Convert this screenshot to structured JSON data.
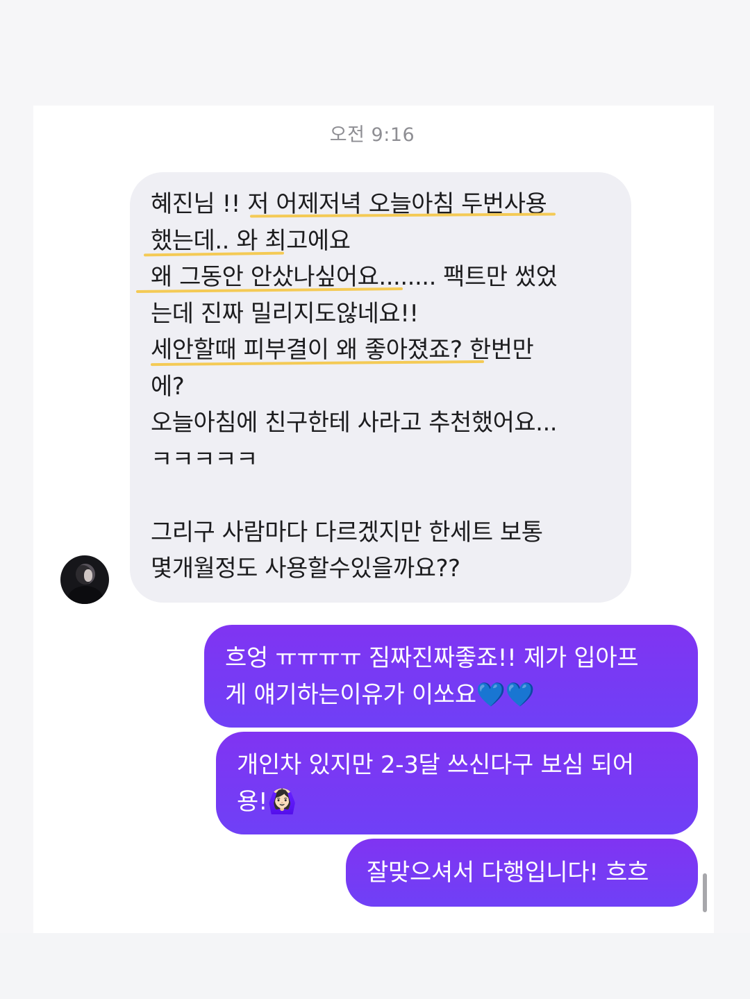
{
  "timestamp": "오전 9:16",
  "incoming_message": {
    "text": "혜진님 !! 저 어제저녁 오늘아침 두번사용\n했는데.. 와 최고에요\n왜 그동안 안샀나싶어요........ 팩트만 썼었\n는데 진짜 밀리지도않네요!!\n세안할때 피부결이 왜 좋아졌죠? 한번만\n에?\n오늘아침에 친구한테 사라고 추천했어요...\nㅋㅋㅋㅋㅋ\n\n그리구 사람마다 다르겠지만 한세트 보통\n몇개월정도 사용할수있을까요??"
  },
  "outgoing_messages": [
    {
      "text": "흐엉 ㅠㅠㅠㅠ 짐짜진짜좋죠!! 제가 입아프\n게 얘기하는이유가 이쏘요💙💙"
    },
    {
      "text": "개인차 있지만 2-3달 쓰신다구 보심 되어\n용!🙆🏻‍♀️"
    },
    {
      "text": "잘맞으셔서 다행입니다! 흐흐"
    }
  ],
  "colors": {
    "incoming_bubble": "#efeff4",
    "outgoing_bubble": "#7b3af5",
    "highlight": "#f4c544",
    "timestamp": "#8e8e93"
  },
  "icons": {
    "avatar": "profile-photo"
  }
}
